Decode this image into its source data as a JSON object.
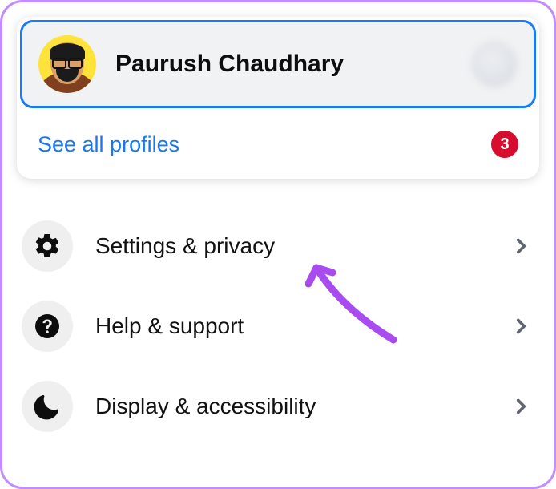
{
  "profile": {
    "name": "Paurush Chaudhary"
  },
  "see_all": {
    "label": "See all profiles",
    "badge": "3"
  },
  "menu": {
    "settings": "Settings & privacy",
    "help": "Help & support",
    "display": "Display & accessibility"
  }
}
